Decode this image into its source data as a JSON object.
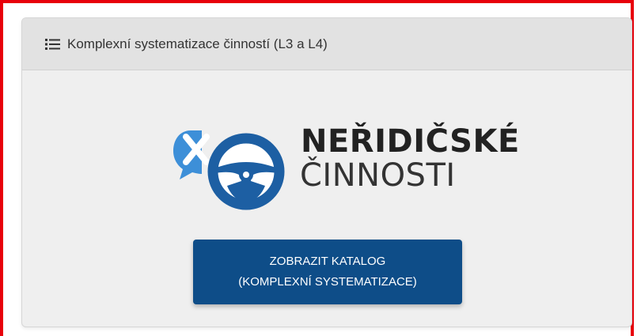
{
  "panel": {
    "header_icon": "list-icon",
    "title": "Komplexní systematizace činností (L3 a L4)"
  },
  "logo": {
    "icon": "steering-wheel-speech-bubble-icon",
    "line1": "NEŘIDIČSKÉ",
    "line2": "ČINNOSTI"
  },
  "catalog_button": {
    "line1": "ZOBRAZIT KATALOG",
    "line2": "(KOMPLEXNÍ SYSTEMATIZACE)"
  },
  "colors": {
    "frame_border": "#e8000b",
    "button_bg": "#0e4d88",
    "logo_blue": "#1d5fa3",
    "logo_light_blue": "#3d8fd8"
  }
}
